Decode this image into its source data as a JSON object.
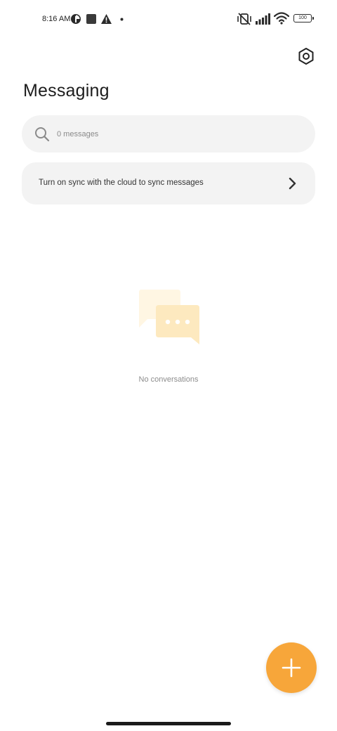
{
  "status_bar": {
    "time": "8:16 AM",
    "battery_level": "100",
    "icons_left": [
      "data-saver-icon",
      "square-notification-icon",
      "alert-icon",
      "dot-icon"
    ],
    "icons_right": [
      "muted-vibrate-icon",
      "signal-icon",
      "wifi-icon",
      "battery-icon"
    ]
  },
  "header": {
    "title": "Messaging",
    "settings_icon": "gear-icon"
  },
  "search": {
    "placeholder": "0 messages"
  },
  "sync_banner": {
    "text": "Turn on sync with the cloud to sync messages"
  },
  "empty_state": {
    "text": "No conversations",
    "illustration": "chat-bubbles-icon"
  },
  "fab": {
    "icon": "plus-icon"
  },
  "colors": {
    "accent": "#f7a63a",
    "surface": "#f3f3f3",
    "illustration_light": "#fff6e3",
    "illustration_dark": "#fde9bf"
  }
}
